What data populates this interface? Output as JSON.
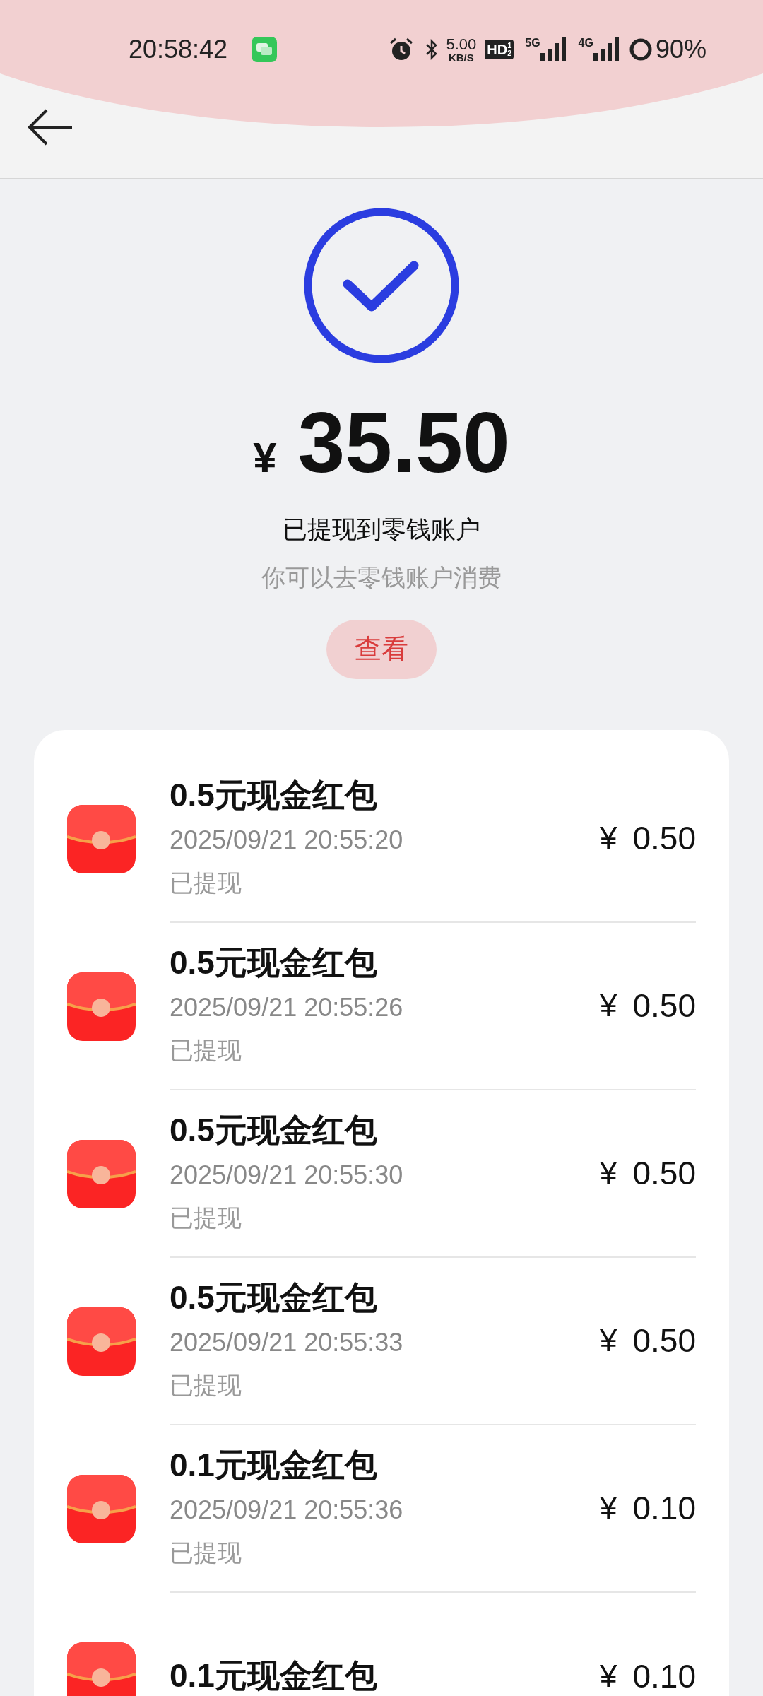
{
  "status_bar": {
    "time": "20:58:42",
    "speed_value": "5.00",
    "speed_unit": "KB/S",
    "hd": "HD",
    "hd_sup": "1",
    "hd_sub": "2",
    "networks": [
      "5G",
      "4G"
    ],
    "battery": "90%"
  },
  "result": {
    "currency": "¥",
    "amount": "35.50",
    "message": "已提现到零钱账户",
    "hint": "你可以去零钱账户消费",
    "view_button": "查看"
  },
  "records": [
    {
      "title": "0.5元现金红包",
      "time": "2025/09/21 20:55:20",
      "status": "已提现",
      "currency": "¥",
      "amount": "0.50"
    },
    {
      "title": "0.5元现金红包",
      "time": "2025/09/21 20:55:26",
      "status": "已提现",
      "currency": "¥",
      "amount": "0.50"
    },
    {
      "title": "0.5元现金红包",
      "time": "2025/09/21 20:55:30",
      "status": "已提现",
      "currency": "¥",
      "amount": "0.50"
    },
    {
      "title": "0.5元现金红包",
      "time": "2025/09/21 20:55:33",
      "status": "已提现",
      "currency": "¥",
      "amount": "0.50"
    },
    {
      "title": "0.1元现金红包",
      "time": "2025/09/21 20:55:36",
      "status": "已提现",
      "currency": "¥",
      "amount": "0.10"
    },
    {
      "title": "0.1元现金红包",
      "currency": "¥",
      "amount": "0.10"
    }
  ]
}
